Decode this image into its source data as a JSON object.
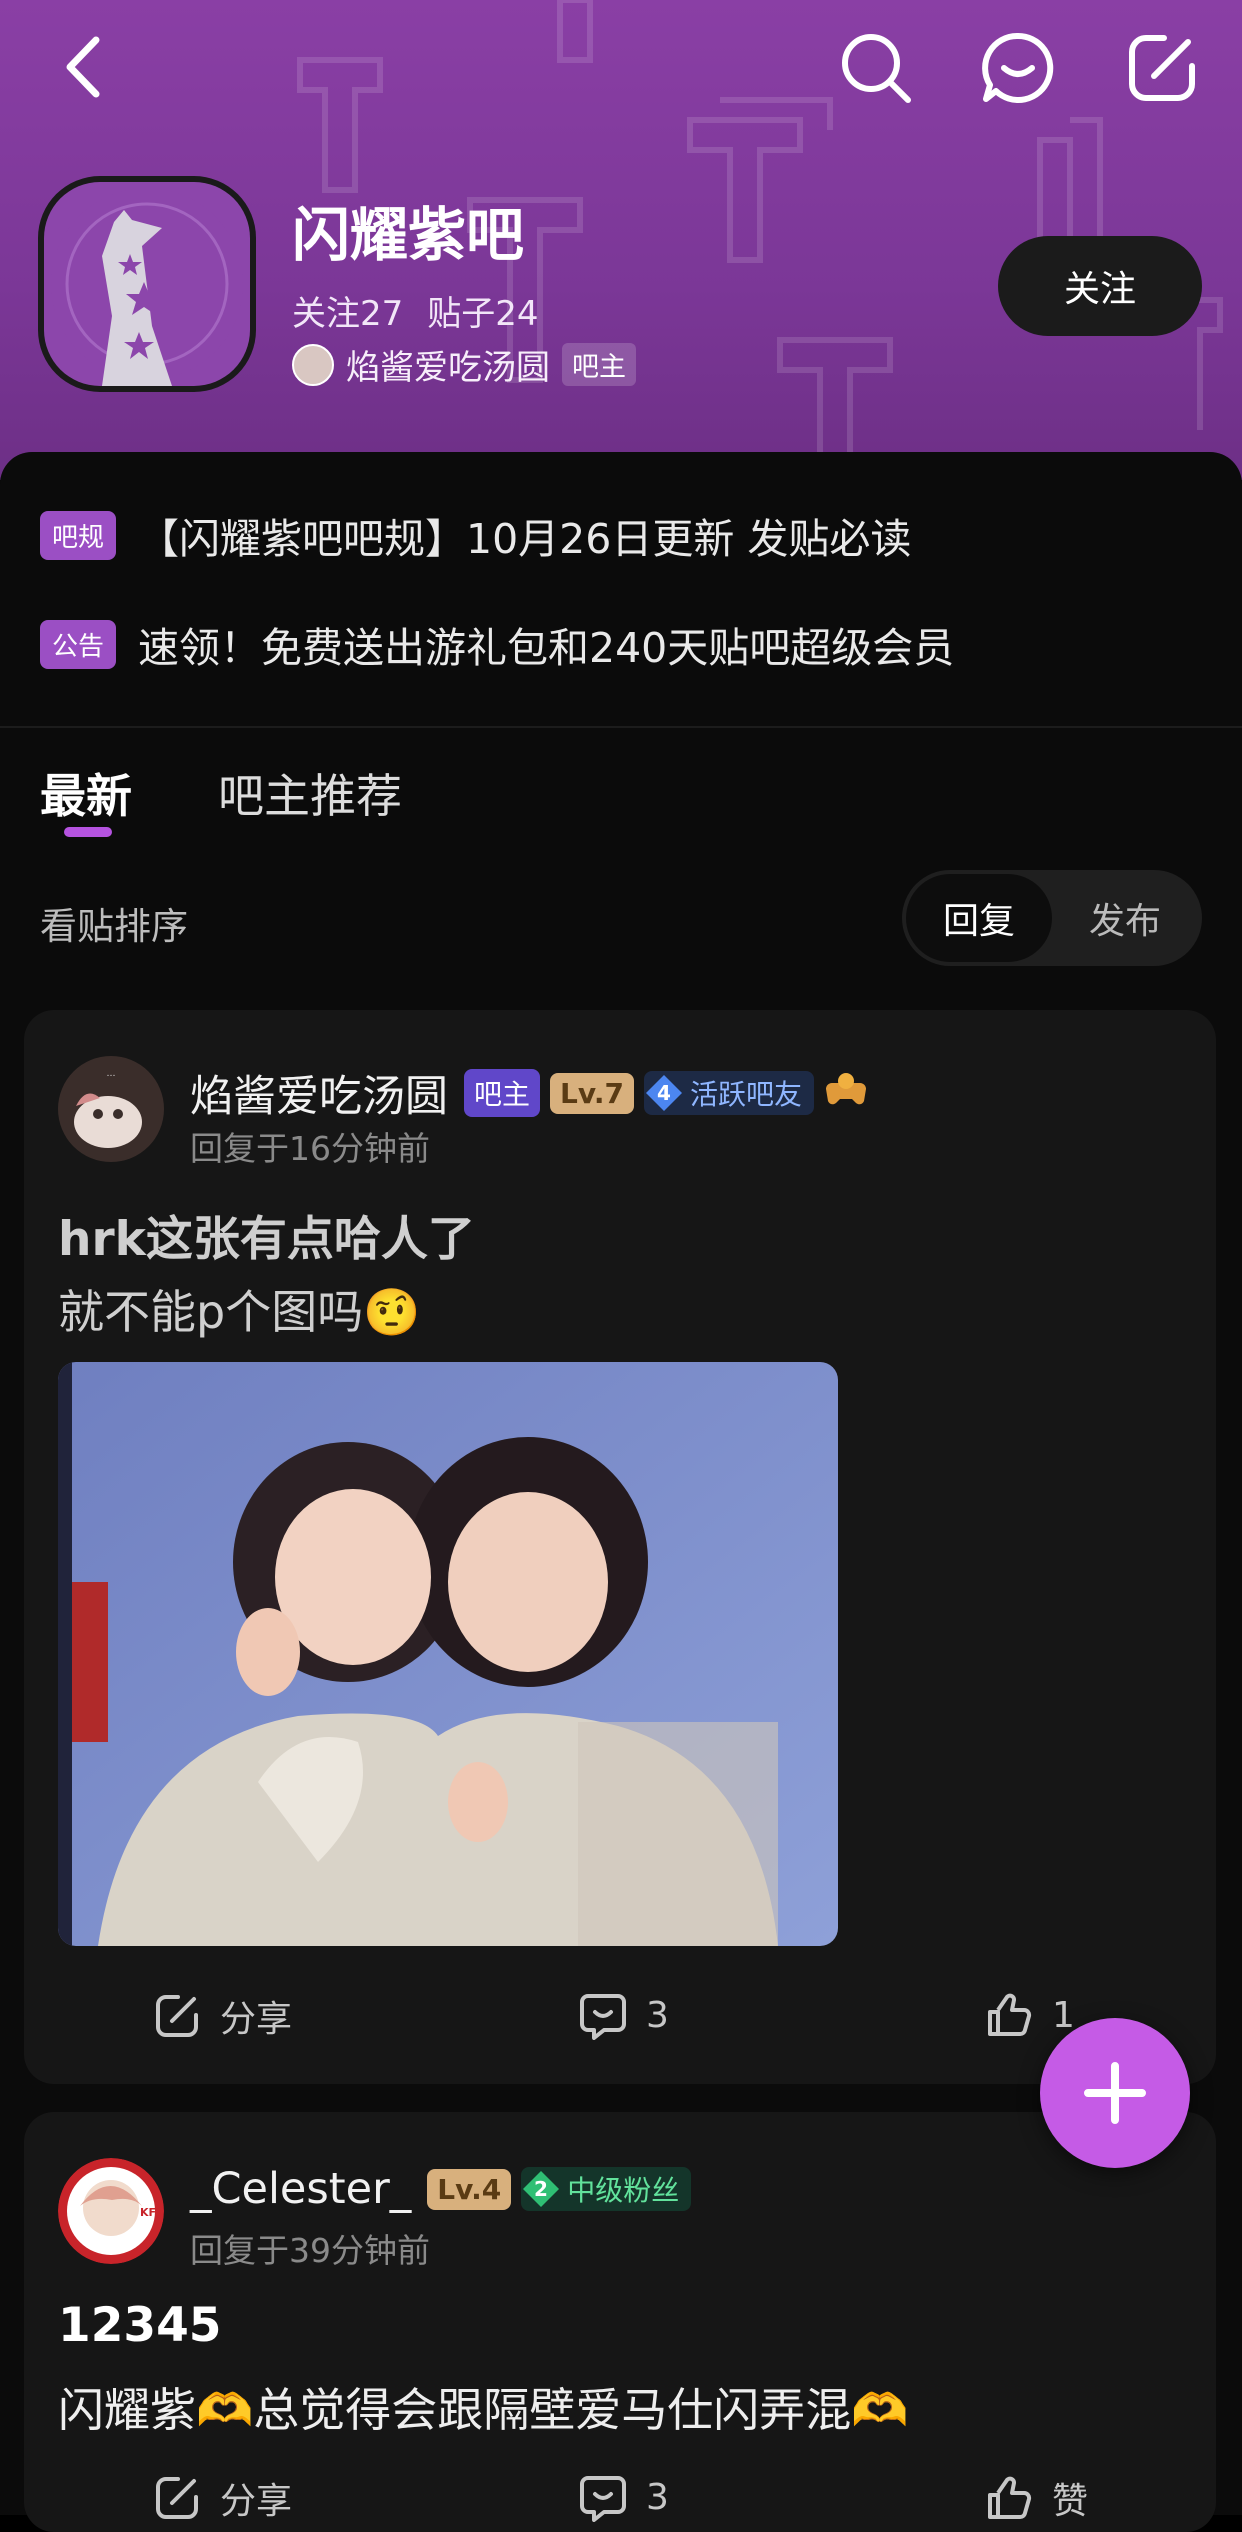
{
  "header": {
    "forum_name": "闪耀紫吧",
    "followers": "关注27",
    "posts": "贴子24",
    "owner_name": "焰酱爱吃汤圆",
    "owner_badge": "吧主",
    "follow_label": "关注",
    "bg_color": "#7b3797"
  },
  "notices": [
    {
      "tag": "吧规",
      "text": "【闪耀紫吧吧规】10月26日更新 发贴必读"
    },
    {
      "tag": "公告",
      "text": "速领！免费送出游礼包和240天贴吧超级会员"
    }
  ],
  "tabs": [
    {
      "label": "最新",
      "active": true
    },
    {
      "label": "吧主推荐",
      "active": false
    }
  ],
  "sort": {
    "label": "看贴排序",
    "options": [
      "回复",
      "发布"
    ],
    "selected": "回复"
  },
  "posts": [
    {
      "author": "焰酱爱吃汤圆",
      "badge_owner": "吧主",
      "level": "Lv.7",
      "rank_num": "4",
      "rank_label": "活跃吧友",
      "time": "回复于16分钟前",
      "title": "hrk这张有点哈人了",
      "body": "就不能p个图吗🤨",
      "share": "分享",
      "comments": "3",
      "likes": "1"
    },
    {
      "author": "_Celester_",
      "level": "Lv.4",
      "rank_num": "2",
      "rank_label": "中级粉丝",
      "time": "回复于39分钟前",
      "title": "12345",
      "body": "闪耀紫🫶总觉得会跟隔壁爱马仕闪弄混🫶",
      "share": "分享",
      "comments": "3",
      "likes": "赞"
    }
  ],
  "accent_color": "#c55be6"
}
